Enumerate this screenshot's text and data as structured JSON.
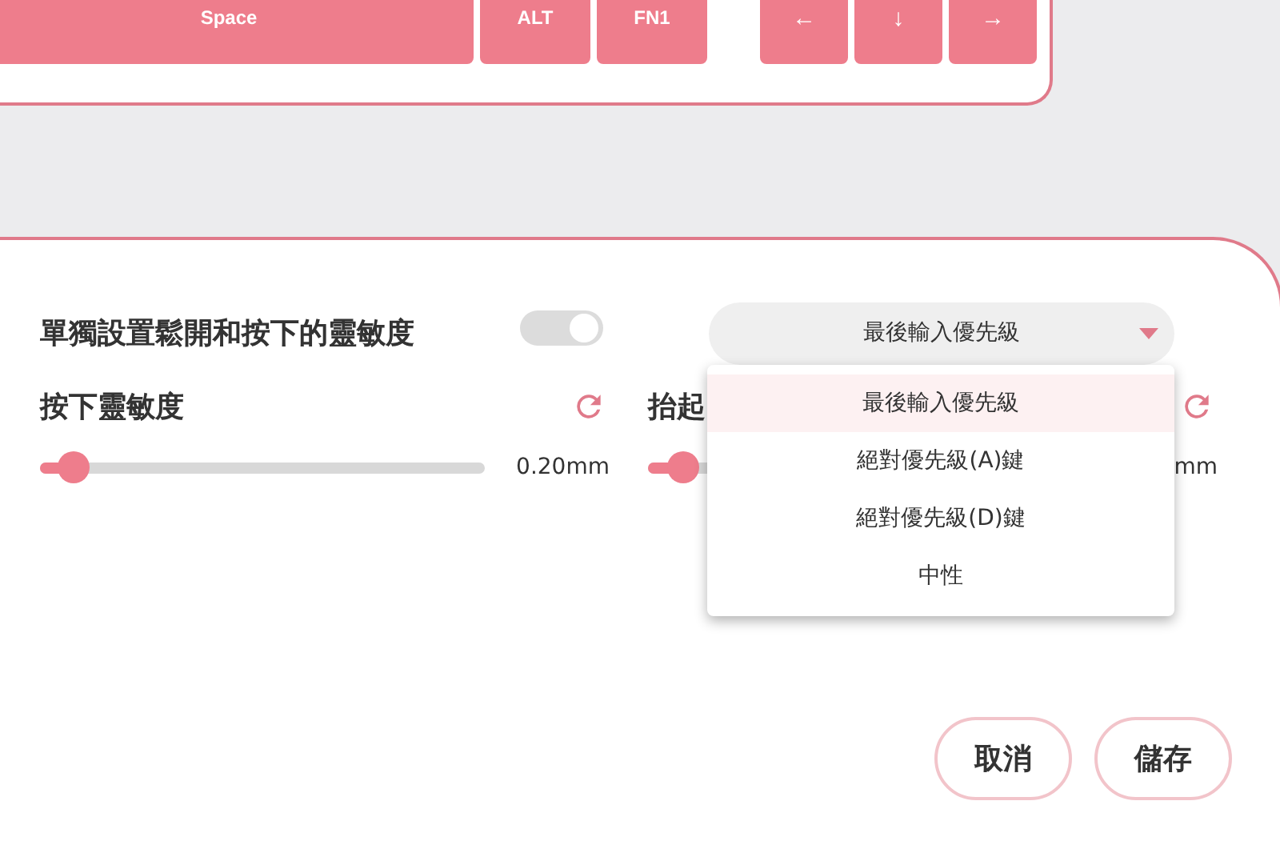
{
  "keyboard": {
    "keys": [
      {
        "label": "Space",
        "kind": "wide"
      },
      {
        "label": "ALT",
        "kind": "normal"
      },
      {
        "label": "FN1",
        "kind": "normal"
      },
      {
        "label": "←",
        "kind": "arrow"
      },
      {
        "label": "↓",
        "kind": "arrow"
      },
      {
        "label": "→",
        "kind": "arrow"
      }
    ]
  },
  "separate_sensitivity": {
    "label": "單獨設置鬆開和按下的靈敏度",
    "on": true
  },
  "priority_dropdown": {
    "value": "最後輸入優先級",
    "options": [
      {
        "label": "最後輸入優先級",
        "selected": true
      },
      {
        "label": "絕對優先級(A)鍵",
        "selected": false
      },
      {
        "label": "絕對優先級(D)鍵",
        "selected": false
      },
      {
        "label": "中性",
        "selected": false
      }
    ]
  },
  "sliders": [
    {
      "label": "按下靈敏度",
      "level": 0.075,
      "reading": "0.20mm"
    },
    {
      "label": "抬起",
      "level": 0.08,
      "reading": "mm"
    }
  ],
  "buttons": [
    {
      "label": "取消"
    },
    {
      "label": "儲存"
    }
  ]
}
